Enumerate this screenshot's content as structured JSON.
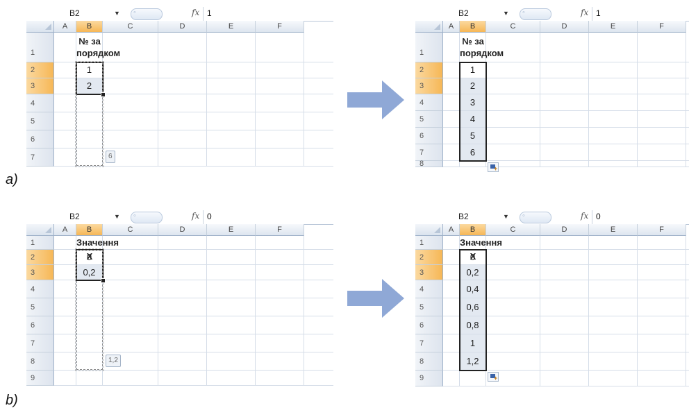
{
  "columns": [
    "A",
    "B",
    "C",
    "D",
    "E",
    "F"
  ],
  "panels": [
    {
      "id": "a-before",
      "part_label": "a)",
      "name_box": "B2",
      "formula_value": "1",
      "rows": [
        "1",
        "2",
        "3",
        "4",
        "5",
        "6",
        "7"
      ],
      "header_line1": "№ за",
      "header_line2": "порядком",
      "values": [
        "1",
        "2"
      ],
      "fill_tooltip": "6"
    },
    {
      "id": "a-after",
      "name_box": "B2",
      "formula_value": "1",
      "rows": [
        "1",
        "2",
        "3",
        "4",
        "5",
        "6",
        "7",
        "8"
      ],
      "header_line1": "№ за",
      "header_line2": "порядком",
      "values": [
        "1",
        "2",
        "3",
        "4",
        "5",
        "6"
      ]
    },
    {
      "id": "b-before",
      "part_label": "b)",
      "name_box": "B2",
      "formula_value": "0",
      "rows": [
        "1",
        "2",
        "3",
        "4",
        "5",
        "6",
        "7",
        "8",
        "9"
      ],
      "header_line1": "Значення X",
      "values": [
        "0",
        "0,2"
      ],
      "fill_tooltip": "1,2"
    },
    {
      "id": "b-after",
      "name_box": "B2",
      "formula_value": "0",
      "rows": [
        "1",
        "2",
        "3",
        "4",
        "5",
        "6",
        "7",
        "8",
        "9"
      ],
      "header_line1": "Значення X",
      "values": [
        "0",
        "0,2",
        "0,4",
        "0,6",
        "0,8",
        "1",
        "1,2"
      ]
    }
  ],
  "icons": {
    "fx": "fx-icon",
    "dropdown": "chevron-down-icon",
    "arrow": "right-arrow-icon",
    "autofill": "auto-fill-options-icon"
  },
  "colors": {
    "selected_header": "#f6b756",
    "shaded_cell": "#e3e9f1",
    "arrow": "#8fa8d6"
  }
}
